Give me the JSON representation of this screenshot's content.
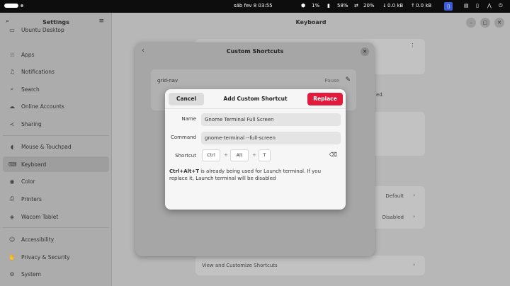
{
  "topbar": {
    "clock": "sáb fev 8  03:55",
    "cpu": "1%",
    "mem": "58%",
    "swap": "20%",
    "net_down": "0.0 kB",
    "net_up": "0.0 kB"
  },
  "sidebar": {
    "title": "Settings",
    "items": [
      {
        "label": "Ubuntu Desktop",
        "icon": "desktop-icon"
      },
      {
        "label": "Apps",
        "icon": "apps-icon"
      },
      {
        "label": "Notifications",
        "icon": "bell-icon"
      },
      {
        "label": "Search",
        "icon": "search-icon"
      },
      {
        "label": "Online Accounts",
        "icon": "cloud-icon"
      },
      {
        "label": "Sharing",
        "icon": "share-icon"
      },
      {
        "label": "Mouse & Touchpad",
        "icon": "mouse-icon"
      },
      {
        "label": "Keyboard",
        "icon": "keyboard-icon"
      },
      {
        "label": "Color",
        "icon": "color-icon"
      },
      {
        "label": "Printers",
        "icon": "printer-icon"
      },
      {
        "label": "Wacom Tablet",
        "icon": "tablet-icon"
      },
      {
        "label": "Accessibility",
        "icon": "accessibility-icon"
      },
      {
        "label": "Privacy & Security",
        "icon": "hand-icon"
      },
      {
        "label": "System",
        "icon": "gear-icon"
      }
    ]
  },
  "main": {
    "title": "Keyboard",
    "default_label": "Default",
    "disabled_label": "Disabled",
    "view_shortcuts": "View and Customize Shortcuts",
    "partial_text": "ed."
  },
  "custom_shortcuts": {
    "title": "Custom Shortcuts",
    "row_name": "grid-nav",
    "row_key": "Pause"
  },
  "add_dialog": {
    "title": "Add Custom Shortcut",
    "cancel": "Cancel",
    "replace": "Replace",
    "name_label": "Name",
    "name_value": "Gnome Terminal Full Screen",
    "command_label": "Command",
    "command_value": "gnome-terminal --full-screen",
    "shortcut_label": "Shortcut",
    "keys": [
      "Ctrl",
      "Alt",
      "T"
    ],
    "warning_bold": "Ctrl+Alt+T",
    "warning_text": " is already being used for Launch terminal. If you replace it, Launch terminal will be disabled"
  },
  "colors": {
    "accent": "#e01b3c"
  }
}
